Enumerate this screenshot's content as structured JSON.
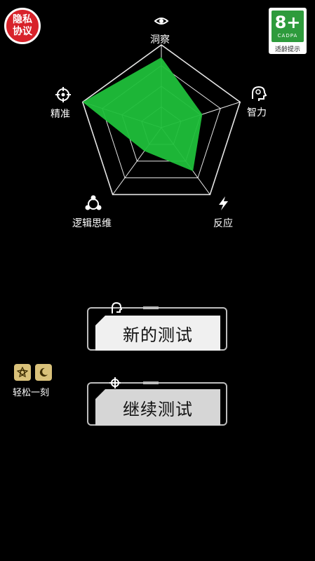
{
  "privacy": {
    "line1": "隐私",
    "line2": "协议"
  },
  "age_rating": {
    "rating": "8+",
    "org": "CADPA",
    "tip": "适龄提示"
  },
  "radar": {
    "labels": {
      "observe": "洞察",
      "intelligence": "智力",
      "reaction": "反应",
      "logic": "逻辑思维",
      "precision": "精准"
    },
    "icons": {
      "observe": "eye-icon",
      "intelligence": "brain-head-icon",
      "reaction": "lightning-icon",
      "logic": "logic-network-icon",
      "precision": "crosshair-icon"
    },
    "fill_color": "#1fbf3a",
    "grid_color": "#ffffff",
    "levels": 4,
    "scores": {
      "observe": 0.85,
      "intelligence": 0.52,
      "reaction": 0.65,
      "logic": 0.35,
      "precision": 1.0
    }
  },
  "relax": {
    "label": "轻松一刻",
    "icons": [
      "flower-icon",
      "moon-icon"
    ]
  },
  "buttons": {
    "new_test": "新的测试",
    "continue_test": "继续测试"
  },
  "button_icons": {
    "new_test": "head-icon",
    "continue_test": "target-icon"
  }
}
